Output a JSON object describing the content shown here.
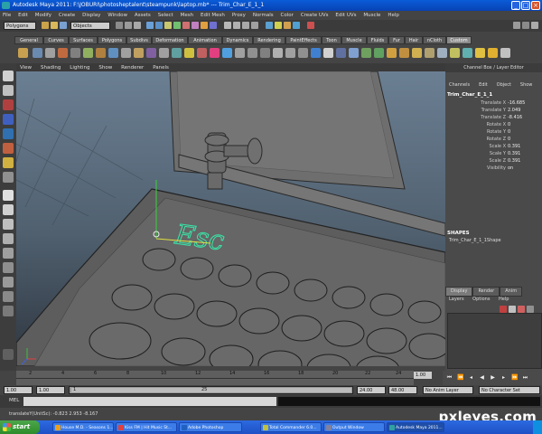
{
  "window": {
    "title": "Autodesk Maya 2011: F:\\JOBURI\\photosheptalent\\steampunk\\laptop.mb*   ---   Trim_Char_E_1_1",
    "minimize": "_",
    "maximize": "□",
    "close": "×"
  },
  "menu": [
    "File",
    "Edit",
    "Modify",
    "Create",
    "Display",
    "Window",
    "Assets",
    "Select",
    "Mesh",
    "Edit Mesh",
    "Proxy",
    "Normals",
    "Color",
    "Create UVs",
    "Edit UVs",
    "Muscle",
    "Help"
  ],
  "status": {
    "mode": "Polygons",
    "selection_mask": "Objects"
  },
  "shelf_tabs": [
    "General",
    "Curves",
    "Surfaces",
    "Polygons",
    "Subdivs",
    "Deformation",
    "Animation",
    "Dynamics",
    "Rendering",
    "PaintEffects",
    "Toon",
    "Muscle",
    "Fluids",
    "Fur",
    "Hair",
    "nCloth",
    "Custom"
  ],
  "shelf_active": "Custom",
  "viewport_menu": [
    "View",
    "Shading",
    "Lighting",
    "Show",
    "Renderer",
    "Panels"
  ],
  "viewport_text": "Esc",
  "channel_box": {
    "header": "Channel Box / Layer Editor",
    "tabs": [
      "Channels",
      "Edit",
      "Object",
      "Show"
    ],
    "object": "Trim_Char_E_1_1",
    "attributes": [
      {
        "name": "Translate X",
        "value": "-16.685"
      },
      {
        "name": "Translate Y",
        "value": "2.049"
      },
      {
        "name": "Translate Z",
        "value": "-8.416"
      },
      {
        "name": "Rotate X",
        "value": "0"
      },
      {
        "name": "Rotate Y",
        "value": "0"
      },
      {
        "name": "Rotate Z",
        "value": "0"
      },
      {
        "name": "Scale X",
        "value": "0.391"
      },
      {
        "name": "Scale Y",
        "value": "0.391"
      },
      {
        "name": "Scale Z",
        "value": "0.391"
      },
      {
        "name": "Visibility",
        "value": "on"
      }
    ],
    "shapes_label": "SHAPES",
    "shape_name": "Trim_Char_E_1_1Shape",
    "layer_tabs": [
      "Display",
      "Render",
      "Anim"
    ],
    "layer_menu": [
      "Layers",
      "Options",
      "Help"
    ]
  },
  "timeline": {
    "ticks": [
      "2",
      "4",
      "6",
      "8",
      "10",
      "12",
      "14",
      "16",
      "18",
      "20",
      "22",
      "24"
    ],
    "current_frame": "1.00"
  },
  "range": {
    "start": "1.00",
    "start2": "1.00",
    "thumb_start": "1",
    "thumb_end": "25",
    "end": "24.00",
    "end2": "48.00",
    "anim_layer": "No Anim Layer",
    "char_set": "No Character Set"
  },
  "command": {
    "label": "MEL"
  },
  "helpline": "translateY(UnitSc): -0.823    2.953    -8.167",
  "taskbar": {
    "start": "start",
    "tasks": [
      {
        "label": "House M.D. - Seasons 1...",
        "color": "#e8a020"
      },
      {
        "label": "Kiss FM | Hit Music St...",
        "color": "#e04040"
      },
      {
        "label": "Adobe Photoshop",
        "color": "#2060c0"
      },
      {
        "label": "Total Commander 6.0...",
        "color": "#c0c040"
      },
      {
        "label": "Output Window",
        "color": "#8080a0"
      },
      {
        "label": "Autodesk Maya 2011...",
        "color": "#30a0a0"
      }
    ]
  },
  "watermark": "pxleyes.com"
}
